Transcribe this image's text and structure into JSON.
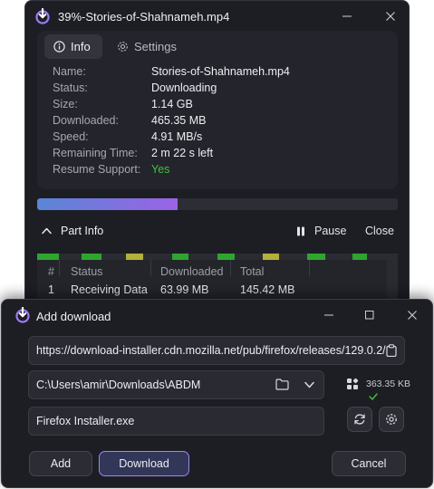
{
  "progress_window": {
    "title": "39%-Stories-of-Shahnameh.mp4",
    "tabs": [
      {
        "label": "Info",
        "icon": "info-icon",
        "active": true
      },
      {
        "label": "Settings",
        "icon": "gear-icon",
        "active": false
      }
    ],
    "info": {
      "name_label": "Name:",
      "name_value": "Stories-of-Shahnameh.mp4",
      "status_label": "Status:",
      "status_value": "Downloading",
      "size_label": "Size:",
      "size_value": "1.14 GB",
      "downloaded_label": "Downloaded:",
      "downloaded_value": "465.35 MB",
      "speed_label": "Speed:",
      "speed_value": "4.91 MB/s",
      "remaining_label": "Remaining Time:",
      "remaining_value": "2 m 22 s left",
      "resume_label": "Resume Support:",
      "resume_value": "Yes"
    },
    "progress_fraction": 0.39,
    "part_info_label": "Part Info",
    "pause_label": "Pause",
    "close_label": "Close",
    "parts_table": {
      "headers": [
        "#",
        "Status",
        "Downloaded",
        "Total"
      ],
      "rows": [
        {
          "index": "1",
          "status": "Receiving Data",
          "downloaded": "63.99 MB",
          "total": "145.42 MB"
        }
      ]
    },
    "colors": {
      "part_done": "#2fa52f",
      "part_active": "#b3b03a",
      "progress_start": "#5a86d6",
      "progress_end": "#9b63e6",
      "yes": "#3dc43a"
    }
  },
  "add_download_window": {
    "title": "Add download",
    "url": "https://download-installer.cdn.mozilla.net/pub/firefox/releases/129.0.2/",
    "folder": "C:\\Users\\amir\\Downloads\\ABDM",
    "file_name": "Firefox Installer.exe",
    "size": "363.35 KB",
    "add_label": "Add",
    "download_label": "Download",
    "cancel_label": "Cancel",
    "colors": {
      "download_border": "#9c86f0"
    }
  }
}
